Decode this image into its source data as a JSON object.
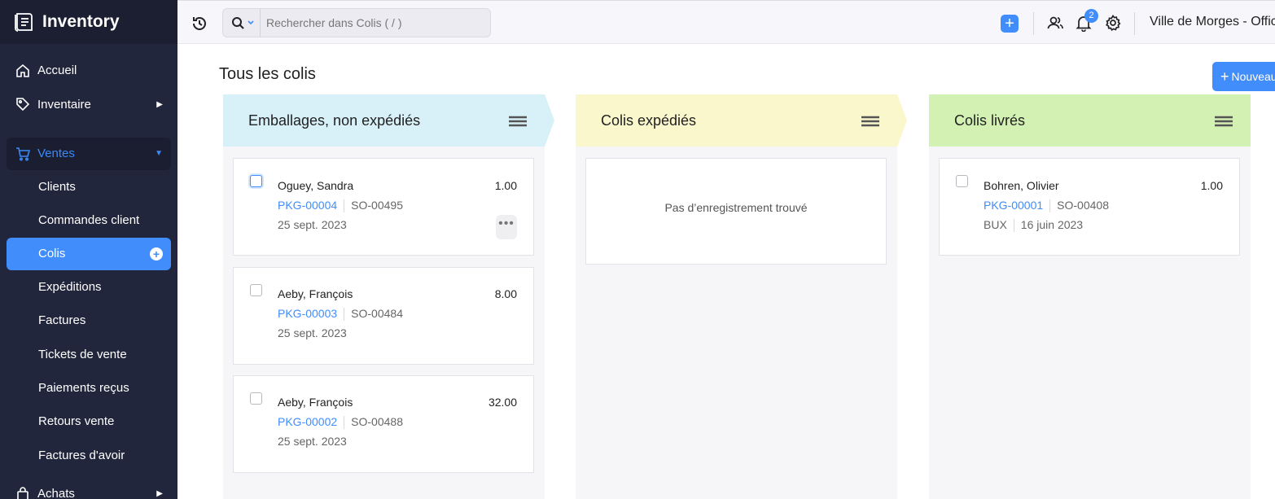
{
  "app": {
    "name": "Inventory"
  },
  "sidebar": {
    "items": [
      {
        "label": "Accueil"
      },
      {
        "label": "Inventaire"
      }
    ],
    "ventes": {
      "label": "Ventes",
      "children": [
        {
          "label": "Clients"
        },
        {
          "label": "Commandes client"
        },
        {
          "label": "Colis",
          "active": true
        },
        {
          "label": "Expéditions"
        },
        {
          "label": "Factures"
        },
        {
          "label": "Tickets de vente"
        },
        {
          "label": "Paiements reçus"
        },
        {
          "label": "Retours vente"
        },
        {
          "label": "Factures d'avoir"
        }
      ]
    },
    "next_group": {
      "label": "Achats"
    }
  },
  "header": {
    "search_placeholder": "Rechercher dans Colis ( / )",
    "notification_count": "2",
    "org_name": "Ville de Morges - Office"
  },
  "page": {
    "title": "Tous les colis",
    "new_button": "Nouveau"
  },
  "columns": [
    {
      "title": "Emballages, non expédiés",
      "color": "#d8f1f9",
      "cards": [
        {
          "name": "Oguey, Sandra",
          "amount": "1.00",
          "pkg": "PKG-00004",
          "so": "SO-00495",
          "date": "25 sept. 2023"
        },
        {
          "name": "Aeby, François",
          "amount": "8.00",
          "pkg": "PKG-00003",
          "so": "SO-00484",
          "date": "25 sept. 2023"
        },
        {
          "name": "Aeby, François",
          "amount": "32.00",
          "pkg": "PKG-00002",
          "so": "SO-00488",
          "date": "25 sept. 2023"
        }
      ]
    },
    {
      "title": "Colis expédiés",
      "color": "#faf7cd",
      "empty_text": "Pas d’enregistrement trouvé"
    },
    {
      "title": "Colis livrés",
      "color": "#d4f1b4",
      "cards": [
        {
          "name": "Bohren, Olivier",
          "amount": "1.00",
          "pkg": "PKG-00001",
          "so": "SO-00408",
          "carrier": "BUX",
          "date": "16 juin 2023"
        }
      ]
    }
  ],
  "colors": {
    "accent": "#408dfb",
    "sidebar_bg": "#21263c"
  }
}
